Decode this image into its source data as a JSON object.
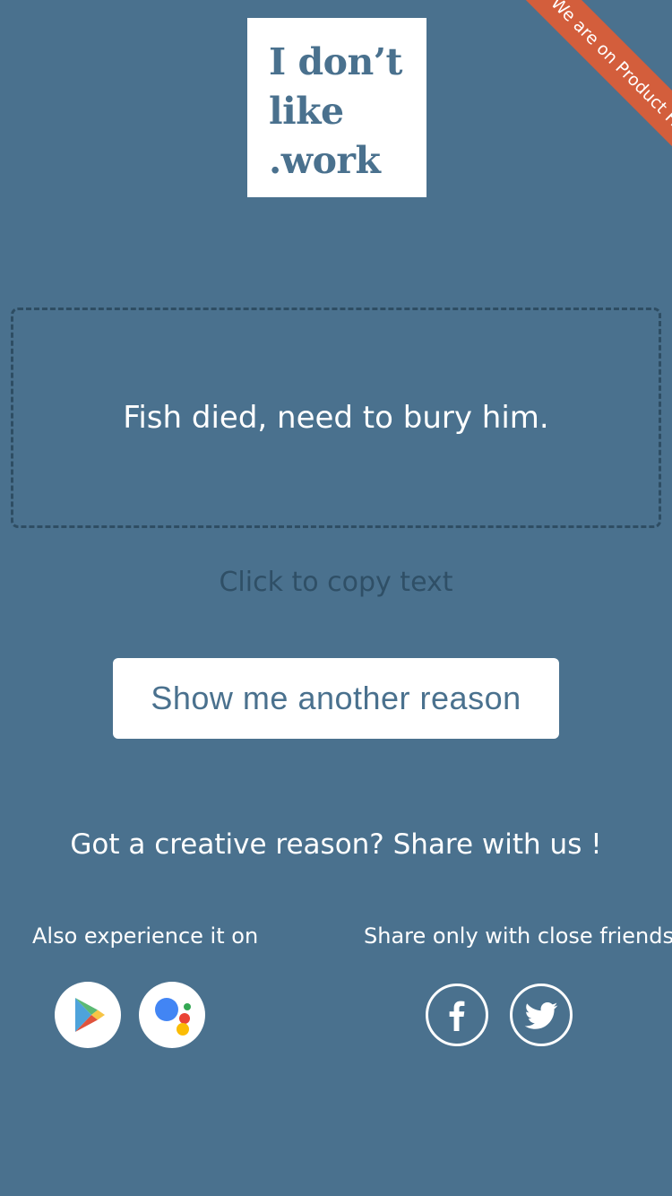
{
  "logo": {
    "line1": "I don’t",
    "line2": "like",
    "line3": ".work"
  },
  "ribbon": {
    "label": "We are on Product Hunt"
  },
  "reason": {
    "text": "Fish died, need to bury him."
  },
  "copy_hint": "Click to copy text",
  "another_button": {
    "label": "Show me another reason"
  },
  "share_reason": "Got a creative reason? Share with us !",
  "also": {
    "label": "Also experience it on",
    "icons": [
      "google-play-icon",
      "google-assistant-icon"
    ]
  },
  "friends": {
    "label": "Share only with close friends",
    "icons": [
      "facebook-icon",
      "twitter-icon"
    ]
  },
  "colors": {
    "background": "#4a718e",
    "ribbon": "#d35e3c",
    "box_border": "#2e4d63",
    "hint_text": "#2f4f66"
  }
}
